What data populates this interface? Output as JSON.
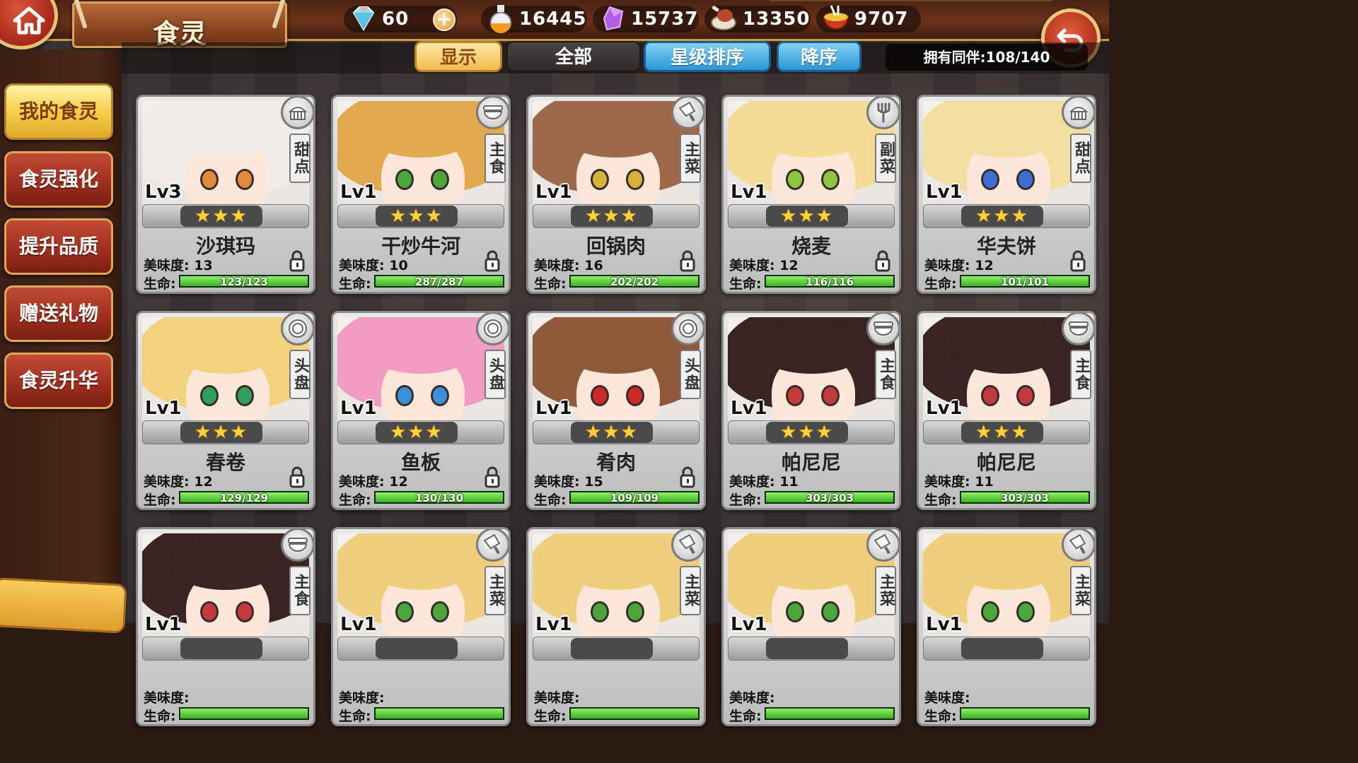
{
  "header": {
    "title": "食灵",
    "currencies": [
      {
        "icon": "diamond-icon",
        "value": "60"
      },
      {
        "icon": "potion-flask-icon",
        "value": "16445"
      },
      {
        "icon": "purple-crystal-icon",
        "value": "15737"
      },
      {
        "icon": "meat-drumstick-icon",
        "value": "13350"
      },
      {
        "icon": "food-bowl-icon",
        "value": "9707"
      }
    ],
    "add_label": "+"
  },
  "filters": {
    "display": "显示",
    "all": "全部",
    "star_sort": "星级排序",
    "descending": "降序",
    "owned": "拥有同伴:108/140"
  },
  "sidebar": {
    "items": [
      {
        "label": "我的食灵",
        "active": true
      },
      {
        "label": "食灵强化",
        "active": false
      },
      {
        "label": "提升品质",
        "active": false
      },
      {
        "label": "赠送礼物",
        "active": false
      },
      {
        "label": "食灵升华",
        "active": false
      }
    ]
  },
  "labels": {
    "taste": "美味度:",
    "hp": "生命:"
  },
  "cards": [
    {
      "name": "沙琪玛",
      "level": "Lv3",
      "type": "甜点",
      "type_icon": "cake-icon",
      "stars": "★★★",
      "taste": "13",
      "hp": "123/123",
      "hp_ratio": 1,
      "hair": "#f1ece8",
      "eye": "#e08a3c",
      "locked": true
    },
    {
      "name": "干炒牛河",
      "level": "Lv1",
      "type": "主食",
      "type_icon": "bowl-icon",
      "stars": "★★★",
      "taste": "10",
      "hp": "287/287",
      "hp_ratio": 1,
      "hair": "#e3a94f",
      "eye": "#4aa83a",
      "locked": true
    },
    {
      "name": "回锅肉",
      "level": "Lv1",
      "type": "主菜",
      "type_icon": "cleaver-icon",
      "stars": "★★★",
      "taste": "16",
      "hp": "202/202",
      "hp_ratio": 1,
      "hair": "#9c6a4b",
      "eye": "#d6b23a",
      "locked": true
    },
    {
      "name": "烧麦",
      "level": "Lv1",
      "type": "副菜",
      "type_icon": "fork-icon",
      "stars": "★★★",
      "taste": "12",
      "hp": "116/116",
      "hp_ratio": 1,
      "hair": "#f4dc97",
      "eye": "#8cc63e",
      "locked": true
    },
    {
      "name": "华夫饼",
      "level": "Lv1",
      "type": "甜点",
      "type_icon": "cake-icon",
      "stars": "★★★",
      "taste": "12",
      "hp": "101/101",
      "hp_ratio": 1,
      "hair": "#f2dfa0",
      "eye": "#3b6fd6",
      "locked": true
    },
    {
      "name": "春卷",
      "level": "Lv1",
      "type": "头盘",
      "type_icon": "plate-icon",
      "stars": "★★★",
      "taste": "12",
      "hp": "129/129",
      "hp_ratio": 1,
      "hair": "#f3d27d",
      "eye": "#2fa05a",
      "locked": true
    },
    {
      "name": "鱼板",
      "level": "Lv1",
      "type": "头盘",
      "type_icon": "plate-icon",
      "stars": "★★★",
      "taste": "12",
      "hp": "130/130",
      "hp_ratio": 1,
      "hair": "#f29bc3",
      "eye": "#3a8fd6",
      "locked": true
    },
    {
      "name": "肴肉",
      "level": "Lv1",
      "type": "头盘",
      "type_icon": "plate-icon",
      "stars": "★★★",
      "taste": "15",
      "hp": "109/109",
      "hp_ratio": 1,
      "hair": "#8f5a3a",
      "eye": "#cc2a2a",
      "locked": true
    },
    {
      "name": "帕尼尼",
      "level": "Lv1",
      "type": "主食",
      "type_icon": "bowl-icon",
      "stars": "★★★",
      "taste": "11",
      "hp": "303/303",
      "hp_ratio": 1,
      "hair": "#3a2422",
      "eye": "#c23a3a",
      "locked": false
    },
    {
      "name": "帕尼尼",
      "level": "Lv1",
      "type": "主食",
      "type_icon": "bowl-icon",
      "stars": "★★★",
      "taste": "11",
      "hp": "303/303",
      "hp_ratio": 1,
      "hair": "#3a2422",
      "eye": "#c23a3a",
      "locked": false
    },
    {
      "name": "",
      "level": "Lv1",
      "type": "主食",
      "type_icon": "bowl-icon",
      "stars": "",
      "taste": "",
      "hp": "",
      "hp_ratio": 1,
      "hair": "#3a2422",
      "eye": "#c23a3a",
      "locked": false
    },
    {
      "name": "",
      "level": "Lv1",
      "type": "主菜",
      "type_icon": "cleaver-icon",
      "stars": "",
      "taste": "",
      "hp": "",
      "hp_ratio": 1,
      "hair": "#efcf7e",
      "eye": "#4aa83a",
      "locked": false
    },
    {
      "name": "",
      "level": "Lv1",
      "type": "主菜",
      "type_icon": "cleaver-icon",
      "stars": "",
      "taste": "",
      "hp": "",
      "hp_ratio": 1,
      "hair": "#efcf7e",
      "eye": "#4aa83a",
      "locked": false
    },
    {
      "name": "",
      "level": "Lv1",
      "type": "主菜",
      "type_icon": "cleaver-icon",
      "stars": "",
      "taste": "",
      "hp": "",
      "hp_ratio": 1,
      "hair": "#efcf7e",
      "eye": "#4aa83a",
      "locked": false
    },
    {
      "name": "",
      "level": "Lv1",
      "type": "主菜",
      "type_icon": "cleaver-icon",
      "stars": "",
      "taste": "",
      "hp": "",
      "hp_ratio": 1,
      "hair": "#efcf7e",
      "eye": "#4aa83a",
      "locked": false
    }
  ]
}
